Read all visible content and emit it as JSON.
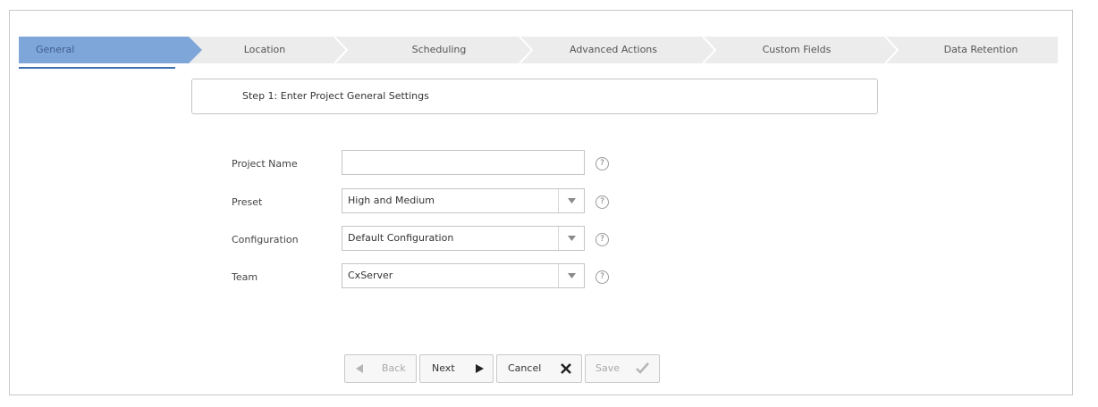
{
  "wizard": {
    "steps": [
      "General",
      "Location",
      "Scheduling",
      "Advanced Actions",
      "Custom Fields",
      "Data Retention"
    ],
    "active_step": "General"
  },
  "step_title": "Step 1: Enter Project General Settings",
  "form": {
    "project_name": {
      "label": "Project Name",
      "value": ""
    },
    "preset": {
      "label": "Preset",
      "value": "High and Medium"
    },
    "configuration": {
      "label": "Configuration",
      "value": "Default Configuration"
    },
    "team": {
      "label": "Team",
      "value": "CxServer"
    },
    "help_glyph": "?"
  },
  "buttons": {
    "back": "Back",
    "next": "Next",
    "cancel": "Cancel",
    "save": "Save"
  },
  "colors": {
    "active_step": "#7fa6d8",
    "accent": "#3d6fae"
  }
}
